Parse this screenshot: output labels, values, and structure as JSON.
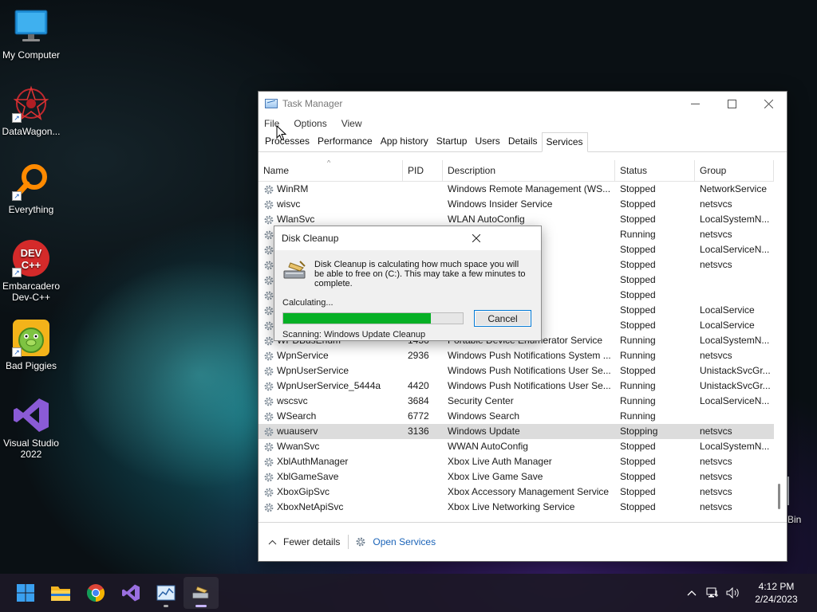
{
  "desktop": {
    "icons": [
      {
        "label": "My Computer"
      },
      {
        "label": "DataWagon..."
      },
      {
        "label": "Everything"
      },
      {
        "label": "Embarcadero Dev-C++"
      },
      {
        "label": "Bad Piggies"
      },
      {
        "label": "Visual Studio 2022"
      }
    ],
    "recycle_bin_label": "Bin"
  },
  "task_manager": {
    "title": "Task Manager",
    "menu": [
      "File",
      "Options",
      "View"
    ],
    "tabs": [
      "Processes",
      "Performance",
      "App history",
      "Startup",
      "Users",
      "Details",
      "Services"
    ],
    "active_tab": "Services",
    "columns": [
      "Name",
      "PID",
      "Description",
      "Status",
      "Group"
    ],
    "rows": [
      {
        "name": "WinRM",
        "pid": "",
        "desc": "Windows Remote Management (WS...",
        "status": "Stopped",
        "group": "NetworkService"
      },
      {
        "name": "wisvc",
        "pid": "",
        "desc": "Windows Insider Service",
        "status": "Stopped",
        "group": "netsvcs"
      },
      {
        "name": "WlanSvc",
        "pid": "",
        "desc": "WLAN AutoConfig",
        "status": "Stopped",
        "group": "LocalSystemN..."
      },
      {
        "name": "",
        "pid": "",
        "desc": "n-in Assistant",
        "status": "Running",
        "group": "netsvcs"
      },
      {
        "name": "",
        "pid": "",
        "desc": "Service",
        "status": "Stopped",
        "group": "LocalServiceN..."
      },
      {
        "name": "",
        "pid": "",
        "desc": "t Service",
        "status": "Stopped",
        "group": "netsvcs"
      },
      {
        "name": "",
        "pid": "",
        "desc": "pter",
        "status": "Stopped",
        "group": ""
      },
      {
        "name": "",
        "pid": "",
        "desc": "r Network Sha...",
        "status": "Stopped",
        "group": ""
      },
      {
        "name": "",
        "pid": "",
        "desc": "",
        "status": "Stopped",
        "group": "LocalService"
      },
      {
        "name": "",
        "pid": "",
        "desc": "",
        "status": "Stopped",
        "group": "LocalService"
      },
      {
        "name": "WPDBusEnum",
        "pid": "1456",
        "desc": "Portable Device Enumerator Service",
        "status": "Running",
        "group": "LocalSystemN..."
      },
      {
        "name": "WpnService",
        "pid": "2936",
        "desc": "Windows Push Notifications System ...",
        "status": "Running",
        "group": "netsvcs"
      },
      {
        "name": "WpnUserService",
        "pid": "",
        "desc": "Windows Push Notifications User Se...",
        "status": "Stopped",
        "group": "UnistackSvcGr..."
      },
      {
        "name": "WpnUserService_5444a",
        "pid": "4420",
        "desc": "Windows Push Notifications User Se...",
        "status": "Running",
        "group": "UnistackSvcGr..."
      },
      {
        "name": "wscsvc",
        "pid": "3684",
        "desc": "Security Center",
        "status": "Running",
        "group": "LocalServiceN..."
      },
      {
        "name": "WSearch",
        "pid": "6772",
        "desc": "Windows Search",
        "status": "Running",
        "group": ""
      },
      {
        "name": "wuauserv",
        "pid": "3136",
        "desc": "Windows Update",
        "status": "Stopping",
        "group": "netsvcs"
      },
      {
        "name": "WwanSvc",
        "pid": "",
        "desc": "WWAN AutoConfig",
        "status": "Stopped",
        "group": "LocalSystemN..."
      },
      {
        "name": "XblAuthManager",
        "pid": "",
        "desc": "Xbox Live Auth Manager",
        "status": "Stopped",
        "group": "netsvcs"
      },
      {
        "name": "XblGameSave",
        "pid": "",
        "desc": "Xbox Live Game Save",
        "status": "Stopped",
        "group": "netsvcs"
      },
      {
        "name": "XboxGipSvc",
        "pid": "",
        "desc": "Xbox Accessory Management Service",
        "status": "Stopped",
        "group": "netsvcs"
      },
      {
        "name": "XboxNetApiSvc",
        "pid": "",
        "desc": "Xbox Live Networking Service",
        "status": "Stopped",
        "group": "netsvcs"
      }
    ],
    "selected_row": "wuauserv",
    "footer": {
      "fewer_details": "Fewer details",
      "open_services": "Open Services"
    }
  },
  "disk_cleanup": {
    "title": "Disk Cleanup",
    "message": "Disk Cleanup is calculating how much space you will be able to free on  (C:). This may take a few minutes to complete.",
    "calculating_label": "Calculating...",
    "progress_fraction": 0.82,
    "cancel_label": "Cancel",
    "scanning_text": "Scanning:  Windows Update Cleanup"
  },
  "taskbar": {
    "apps": [
      "start",
      "file-explorer",
      "chrome",
      "visual-studio",
      "task-manager",
      "disk-cleanup"
    ],
    "active_app": "disk-cleanup",
    "time": "4:12 PM",
    "date": "2/24/2023"
  },
  "colors": {
    "progress": "#06b025",
    "link": "#1a63b8",
    "selected_row": "#dcdcdc"
  }
}
